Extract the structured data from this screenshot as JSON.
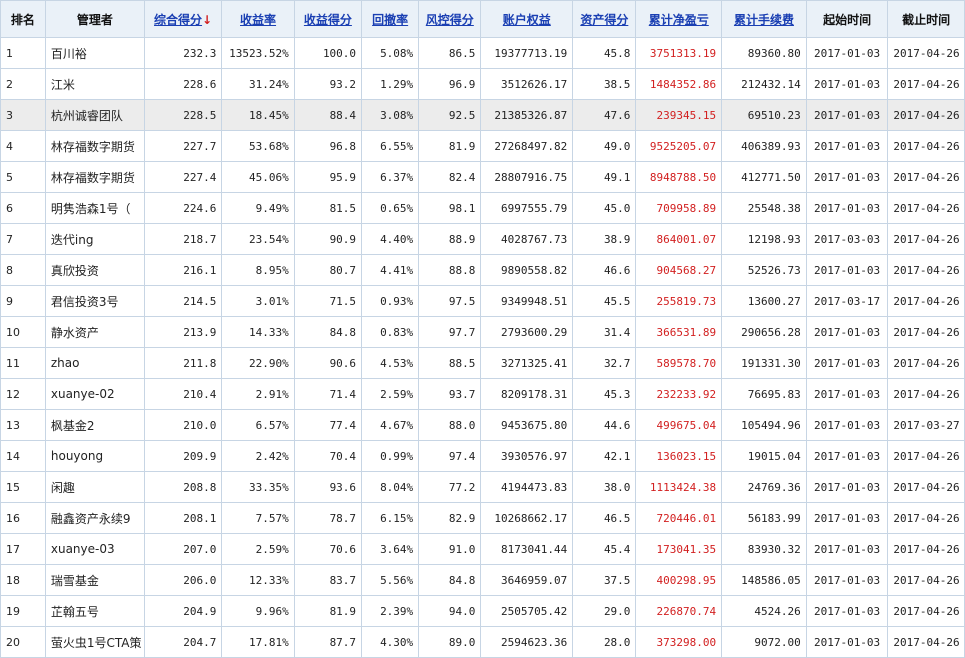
{
  "headers": {
    "rank": "排名",
    "manager": "管理者",
    "composite": "综合得分",
    "sort_arrow": "↓",
    "return_rate": "收益率",
    "return_score": "收益得分",
    "drawdown": "回撤率",
    "risk_score": "风控得分",
    "equity": "账户权益",
    "asset_score": "资产得分",
    "net_pnl": "累计净盈亏",
    "fees": "累计手续费",
    "start": "起始时间",
    "end": "截止时间"
  },
  "rows": [
    {
      "rank": "1",
      "name": "百川裕",
      "composite": "232.3",
      "return_rate": "13523.52%",
      "return_score": "100.0",
      "drawdown": "5.08%",
      "risk_score": "86.5",
      "equity": "19377713.19",
      "asset_score": "45.8",
      "net_pnl": "3751313.19",
      "fees": "89360.80",
      "start": "2017-01-03",
      "end": "2017-04-26"
    },
    {
      "rank": "2",
      "name": "江米",
      "composite": "228.6",
      "return_rate": "31.24%",
      "return_score": "93.2",
      "drawdown": "1.29%",
      "risk_score": "96.9",
      "equity": "3512626.17",
      "asset_score": "38.5",
      "net_pnl": "1484352.86",
      "fees": "212432.14",
      "start": "2017-01-03",
      "end": "2017-04-26"
    },
    {
      "rank": "3",
      "name": "杭州诚睿团队",
      "composite": "228.5",
      "return_rate": "18.45%",
      "return_score": "88.4",
      "drawdown": "3.08%",
      "risk_score": "92.5",
      "equity": "21385326.87",
      "asset_score": "47.6",
      "net_pnl": "239345.15",
      "fees": "69510.23",
      "start": "2017-01-03",
      "end": "2017-04-26"
    },
    {
      "rank": "4",
      "name": "林存福数字期货",
      "composite": "227.7",
      "return_rate": "53.68%",
      "return_score": "96.8",
      "drawdown": "6.55%",
      "risk_score": "81.9",
      "equity": "27268497.82",
      "asset_score": "49.0",
      "net_pnl": "9525205.07",
      "fees": "406389.93",
      "start": "2017-01-03",
      "end": "2017-04-26"
    },
    {
      "rank": "5",
      "name": "林存福数字期货",
      "composite": "227.4",
      "return_rate": "45.06%",
      "return_score": "95.9",
      "drawdown": "6.37%",
      "risk_score": "82.4",
      "equity": "28807916.75",
      "asset_score": "49.1",
      "net_pnl": "8948788.50",
      "fees": "412771.50",
      "start": "2017-01-03",
      "end": "2017-04-26"
    },
    {
      "rank": "6",
      "name": "明隽浩森1号（",
      "composite": "224.6",
      "return_rate": "9.49%",
      "return_score": "81.5",
      "drawdown": "0.65%",
      "risk_score": "98.1",
      "equity": "6997555.79",
      "asset_score": "45.0",
      "net_pnl": "709958.89",
      "fees": "25548.38",
      "start": "2017-01-03",
      "end": "2017-04-26"
    },
    {
      "rank": "7",
      "name": "迭代ing",
      "composite": "218.7",
      "return_rate": "23.54%",
      "return_score": "90.9",
      "drawdown": "4.40%",
      "risk_score": "88.9",
      "equity": "4028767.73",
      "asset_score": "38.9",
      "net_pnl": "864001.07",
      "fees": "12198.93",
      "start": "2017-03-03",
      "end": "2017-04-26"
    },
    {
      "rank": "8",
      "name": "真欣投资",
      "composite": "216.1",
      "return_rate": "8.95%",
      "return_score": "80.7",
      "drawdown": "4.41%",
      "risk_score": "88.8",
      "equity": "9890558.82",
      "asset_score": "46.6",
      "net_pnl": "904568.27",
      "fees": "52526.73",
      "start": "2017-01-03",
      "end": "2017-04-26"
    },
    {
      "rank": "9",
      "name": "君信投资3号",
      "composite": "214.5",
      "return_rate": "3.01%",
      "return_score": "71.5",
      "drawdown": "0.93%",
      "risk_score": "97.5",
      "equity": "9349948.51",
      "asset_score": "45.5",
      "net_pnl": "255819.73",
      "fees": "13600.27",
      "start": "2017-03-17",
      "end": "2017-04-26"
    },
    {
      "rank": "10",
      "name": "静水资产",
      "composite": "213.9",
      "return_rate": "14.33%",
      "return_score": "84.8",
      "drawdown": "0.83%",
      "risk_score": "97.7",
      "equity": "2793600.29",
      "asset_score": "31.4",
      "net_pnl": "366531.89",
      "fees": "290656.28",
      "start": "2017-01-03",
      "end": "2017-04-26"
    },
    {
      "rank": "11",
      "name": "zhao",
      "composite": "211.8",
      "return_rate": "22.90%",
      "return_score": "90.6",
      "drawdown": "4.53%",
      "risk_score": "88.5",
      "equity": "3271325.41",
      "asset_score": "32.7",
      "net_pnl": "589578.70",
      "fees": "191331.30",
      "start": "2017-01-03",
      "end": "2017-04-26"
    },
    {
      "rank": "12",
      "name": "xuanye-02",
      "composite": "210.4",
      "return_rate": "2.91%",
      "return_score": "71.4",
      "drawdown": "2.59%",
      "risk_score": "93.7",
      "equity": "8209178.31",
      "asset_score": "45.3",
      "net_pnl": "232233.92",
      "fees": "76695.83",
      "start": "2017-01-03",
      "end": "2017-04-26"
    },
    {
      "rank": "13",
      "name": "枫基金2",
      "composite": "210.0",
      "return_rate": "6.57%",
      "return_score": "77.4",
      "drawdown": "4.67%",
      "risk_score": "88.0",
      "equity": "9453675.80",
      "asset_score": "44.6",
      "net_pnl": "499675.04",
      "fees": "105494.96",
      "start": "2017-01-03",
      "end": "2017-03-27"
    },
    {
      "rank": "14",
      "name": "houyong",
      "composite": "209.9",
      "return_rate": "2.42%",
      "return_score": "70.4",
      "drawdown": "0.99%",
      "risk_score": "97.4",
      "equity": "3930576.97",
      "asset_score": "42.1",
      "net_pnl": "136023.15",
      "fees": "19015.04",
      "start": "2017-01-03",
      "end": "2017-04-26"
    },
    {
      "rank": "15",
      "name": "闲趣",
      "composite": "208.8",
      "return_rate": "33.35%",
      "return_score": "93.6",
      "drawdown": "8.04%",
      "risk_score": "77.2",
      "equity": "4194473.83",
      "asset_score": "38.0",
      "net_pnl": "1113424.38",
      "fees": "24769.36",
      "start": "2017-01-03",
      "end": "2017-04-26"
    },
    {
      "rank": "16",
      "name": "融鑫资产永续9",
      "composite": "208.1",
      "return_rate": "7.57%",
      "return_score": "78.7",
      "drawdown": "6.15%",
      "risk_score": "82.9",
      "equity": "10268662.17",
      "asset_score": "46.5",
      "net_pnl": "720446.01",
      "fees": "56183.99",
      "start": "2017-01-03",
      "end": "2017-04-26"
    },
    {
      "rank": "17",
      "name": "xuanye-03",
      "composite": "207.0",
      "return_rate": "2.59%",
      "return_score": "70.6",
      "drawdown": "3.64%",
      "risk_score": "91.0",
      "equity": "8173041.44",
      "asset_score": "45.4",
      "net_pnl": "173041.35",
      "fees": "83930.32",
      "start": "2017-01-03",
      "end": "2017-04-26"
    },
    {
      "rank": "18",
      "name": "瑞雪基金",
      "composite": "206.0",
      "return_rate": "12.33%",
      "return_score": "83.7",
      "drawdown": "5.56%",
      "risk_score": "84.8",
      "equity": "3646959.07",
      "asset_score": "37.5",
      "net_pnl": "400298.95",
      "fees": "148586.05",
      "start": "2017-01-03",
      "end": "2017-04-26"
    },
    {
      "rank": "19",
      "name": "芷翰五号",
      "composite": "204.9",
      "return_rate": "9.96%",
      "return_score": "81.9",
      "drawdown": "2.39%",
      "risk_score": "94.0",
      "equity": "2505705.42",
      "asset_score": "29.0",
      "net_pnl": "226870.74",
      "fees": "4524.26",
      "start": "2017-01-03",
      "end": "2017-04-26"
    },
    {
      "rank": "20",
      "name": "萤火虫1号CTA策",
      "composite": "204.7",
      "return_rate": "17.81%",
      "return_score": "87.7",
      "drawdown": "4.30%",
      "risk_score": "89.0",
      "equity": "2594623.36",
      "asset_score": "28.0",
      "net_pnl": "373298.00",
      "fees": "9072.00",
      "start": "2017-01-03",
      "end": "2017-04-26"
    }
  ],
  "highlight_row": 2,
  "colors": {
    "header_bg": "#eaf1f8",
    "border": "#c7d5e4",
    "link": "#1a3fb3",
    "pnl": "#d21f1f",
    "highlight": "#ececec"
  }
}
